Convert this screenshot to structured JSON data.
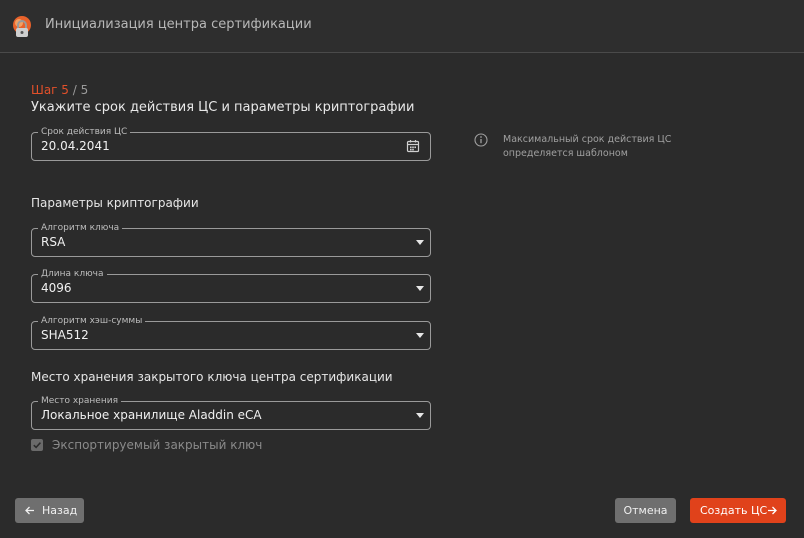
{
  "window": {
    "title": "Инициализация центра сертификации"
  },
  "wizard": {
    "step_current": "Шаг 5",
    "step_total": " / 5",
    "heading": "Укажите срок действия ЦС и параметры криптографии"
  },
  "validity": {
    "label": "Срок действия ЦС",
    "value": "20.04.2041",
    "info": "Максимальный срок действия ЦС определяется шаблоном"
  },
  "crypto": {
    "section_title": "Параметры криптографии",
    "key_algorithm": {
      "label": "Алгоритм ключа",
      "value": "RSA"
    },
    "key_length": {
      "label": "Длина ключа",
      "value": "4096"
    },
    "hash_algorithm": {
      "label": "Алгоритм хэш-суммы",
      "value": "SHA512"
    }
  },
  "storage": {
    "section_title": "Место хранения закрытого ключа центра сертификации",
    "location": {
      "label": "Место хранения",
      "value": "Локальное хранилище Aladdin eCA"
    },
    "exportable_label": "Экспортируемый закрытый ключ",
    "exportable_checked": true
  },
  "buttons": {
    "back": "Назад",
    "cancel": "Отмена",
    "create": "Создать ЦС"
  },
  "colors": {
    "accent": "#e0421b",
    "background": "#2b2b2b",
    "secondary_button": "#6f6f6f"
  },
  "icons": [
    "app-logo-icon",
    "calendar-icon",
    "info-icon",
    "chevron-down-icon",
    "arrow-left-icon",
    "arrow-right-icon",
    "checkmark-icon"
  ]
}
